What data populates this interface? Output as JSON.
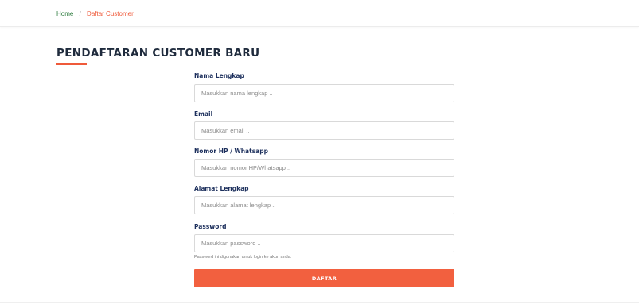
{
  "breadcrumb": {
    "home": "Home",
    "separator": "/",
    "current": "Daftar Customer"
  },
  "page": {
    "title": "PENDAFTARAN CUSTOMER BARU"
  },
  "form": {
    "fields": [
      {
        "label": "Nama Lengkap",
        "placeholder": "Masukkan nama lengkap ..",
        "value": ""
      },
      {
        "label": "Email",
        "placeholder": "Masukkan email ..",
        "value": ""
      },
      {
        "label": "Nomor HP / Whatsapp",
        "placeholder": "Masukkan nomor HP/Whatsapp ..",
        "value": ""
      },
      {
        "label": "Alamat Lengkap",
        "placeholder": "Masukkan alamat lengkap ..",
        "value": ""
      },
      {
        "label": "Password",
        "placeholder": "Masukkan password ..",
        "value": ""
      }
    ],
    "password_help": "Password ini digunakan untuk login ke akun anda.",
    "submit_label": "DAFTAR"
  },
  "colors": {
    "accent": "#ef5a3a",
    "button": "#f2603f",
    "label": "#1c2f5c",
    "home_link": "#2a7a3b"
  }
}
